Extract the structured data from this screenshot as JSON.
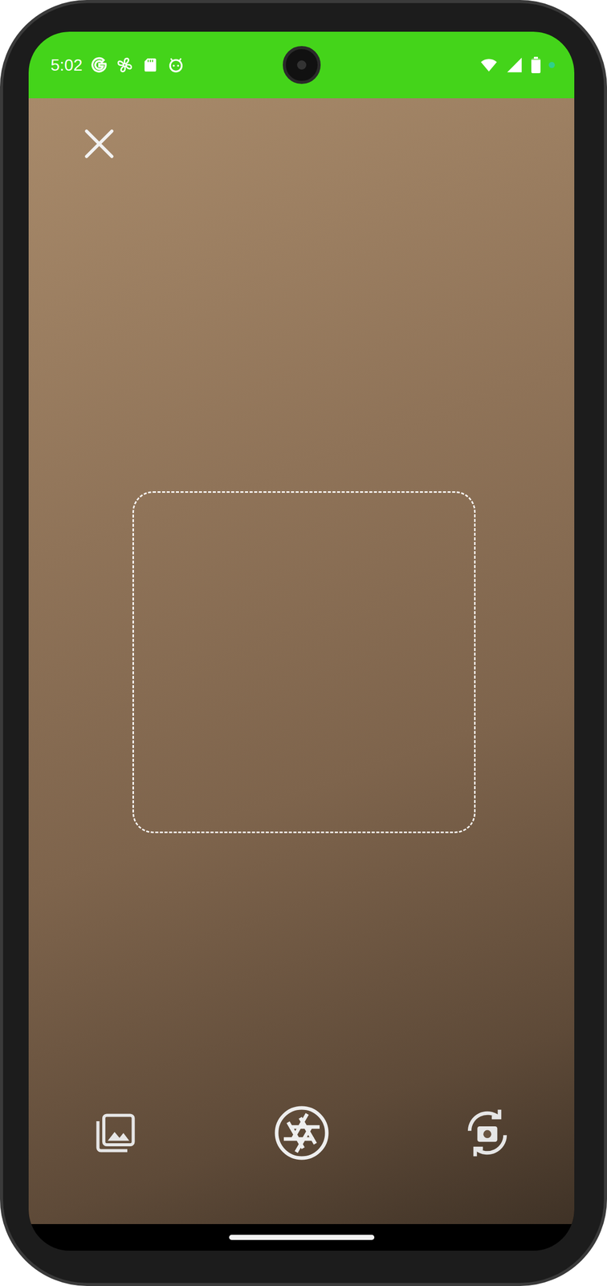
{
  "status_bar": {
    "time": "5:02",
    "battery": {
      "level": 0.9
    }
  }
}
